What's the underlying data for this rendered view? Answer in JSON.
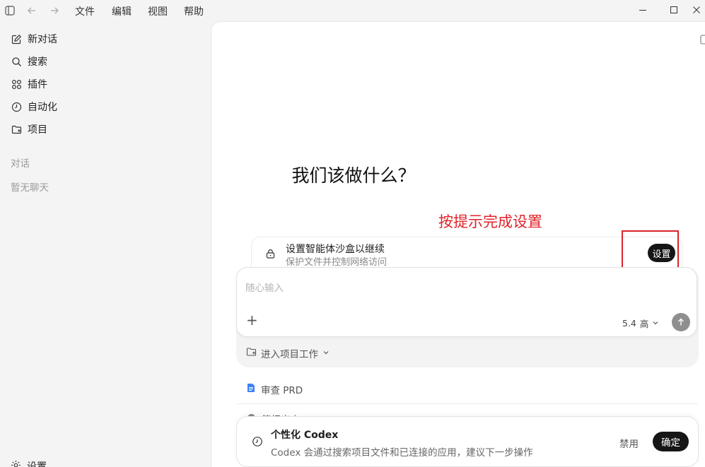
{
  "titlebar": {
    "menus": [
      "文件",
      "编辑",
      "视图",
      "帮助"
    ],
    "icons": [
      "sidebar-toggle-icon",
      "back-arrow-icon",
      "forward-arrow-icon",
      "minimize-icon",
      "maximize-icon",
      "close-icon"
    ]
  },
  "sidebar": {
    "items": [
      {
        "label": "新对话",
        "icon": "edit-icon"
      },
      {
        "label": "搜索",
        "icon": "search-icon"
      },
      {
        "label": "插件",
        "icon": "plugins-icon"
      },
      {
        "label": "自动化",
        "icon": "clock-icon"
      },
      {
        "label": "项目",
        "icon": "folder-icon"
      }
    ],
    "section_label": "对话",
    "empty_text": "暂无聊天",
    "settings_label": "设置"
  },
  "main": {
    "heading": "我们该做什么？",
    "annotation": "按提示完成设置",
    "sandbox": {
      "title": "设置智能体沙盒以继续",
      "subtitle": "保护文件并控制网络访问",
      "button": "设置"
    },
    "composer": {
      "placeholder": "随心输入",
      "model": "5.4",
      "effort": "高"
    },
    "project_link": "进入项目工作",
    "suggestions": [
      {
        "label": "审查 PRD",
        "icon": "doc-icon"
      },
      {
        "label": "简报出来",
        "icon": "chat-icon"
      }
    ],
    "personalize": {
      "title": "个性化 Codex",
      "subtitle": "Codex 会通过搜索项目文件和已连接的应用，建议下一步操作",
      "disable": "禁用",
      "confirm": "确定"
    }
  },
  "colors": {
    "annotation_red": "#e0242a",
    "button_dark": "#161616",
    "send_gray": "#8f8f8f",
    "doc_blue": "#3b82f6"
  }
}
